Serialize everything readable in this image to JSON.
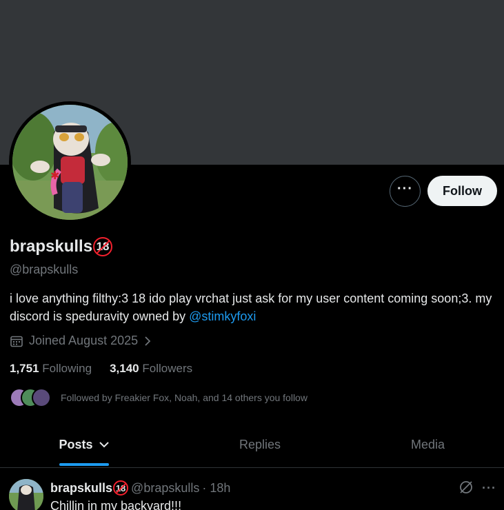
{
  "profile": {
    "display_name": "brapskulls",
    "badge": "18",
    "handle": "@brapskulls",
    "bio_text": "i love anything filthy:3 18 ido play vrchat just ask for my user content coming soon;3. my discord is speduravity owned by ",
    "bio_link": "@stimkyfoxi",
    "joined": "Joined August 2025",
    "following_count": "1,751",
    "following_label": "Following",
    "followers_count": "3,140",
    "followers_label": "Followers",
    "followed_by": "Followed by Freakier Fox, Noah, and 14 others you follow"
  },
  "actions": {
    "more_label": "···",
    "follow_label": "Follow"
  },
  "tabs": [
    {
      "label": "Posts",
      "active": true
    },
    {
      "label": "Replies",
      "active": false
    },
    {
      "label": "Media",
      "active": false
    }
  ],
  "post": {
    "name": "brapskulls",
    "badge": "18",
    "handle": "@brapskulls",
    "time": "· 18h",
    "text": "Chillin in my backyard!!!",
    "more_label": "···"
  },
  "icons": {
    "calendar": "calendar-icon",
    "chevron_right": "chevron-right-icon",
    "chevron_down": "chevron-down-icon",
    "grok": "grok-icon",
    "more": "more-icon"
  },
  "colors": {
    "accent": "#1d9bf0",
    "badge_red": "#f4212e",
    "banner": "#333639",
    "secondary_text": "#71767b"
  }
}
